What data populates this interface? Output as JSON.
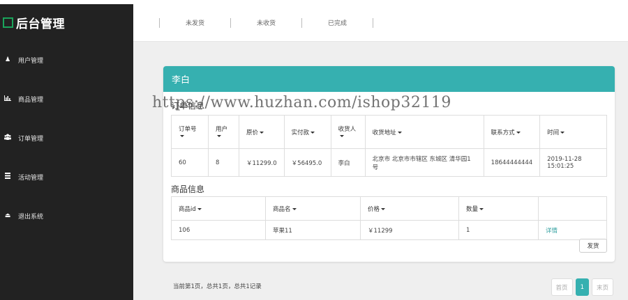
{
  "sidebar": {
    "title": "后台管理",
    "items": [
      {
        "label": "用户管理",
        "icon": "user-icon"
      },
      {
        "label": "商品管理",
        "icon": "bar-chart-icon"
      },
      {
        "label": "订单管理",
        "icon": "group-icon"
      },
      {
        "label": "活动管理",
        "icon": "list-icon"
      },
      {
        "label": "退出系统",
        "icon": "eject-icon"
      }
    ]
  },
  "tabs": [
    "未发货",
    "未收货",
    "已完成"
  ],
  "panel": {
    "header": "李白",
    "order_section_title": "订单信息",
    "order_columns": [
      "订单号",
      "用户",
      "原价",
      "实付款",
      "收货人",
      "收货地址",
      "联系方式",
      "时间"
    ],
    "order_row": [
      "60",
      "8",
      "￥11299.0",
      "￥56495.0",
      "李白",
      "北京市 北京市市辖区 东城区 清华园1号",
      "18644444444",
      "2019-11-28 15:01:25"
    ],
    "goods_section_title": "商品信息",
    "goods_columns": [
      "商品id",
      "商品名",
      "价格",
      "数量",
      ""
    ],
    "goods_row": [
      "106",
      "苹果11",
      "￥11299",
      "1",
      "详情"
    ],
    "ship_button": "发货"
  },
  "watermark": "https://www.huzhan.com/ishop32119",
  "footer": {
    "info": "当前第1页，总共1页，总共1记录",
    "pager": {
      "first": "首页",
      "current": "1",
      "last": "末页"
    }
  },
  "colors": {
    "accent": "#36b0b0",
    "sidebar_bg": "#222222",
    "brand_green": "#1aa45b"
  }
}
